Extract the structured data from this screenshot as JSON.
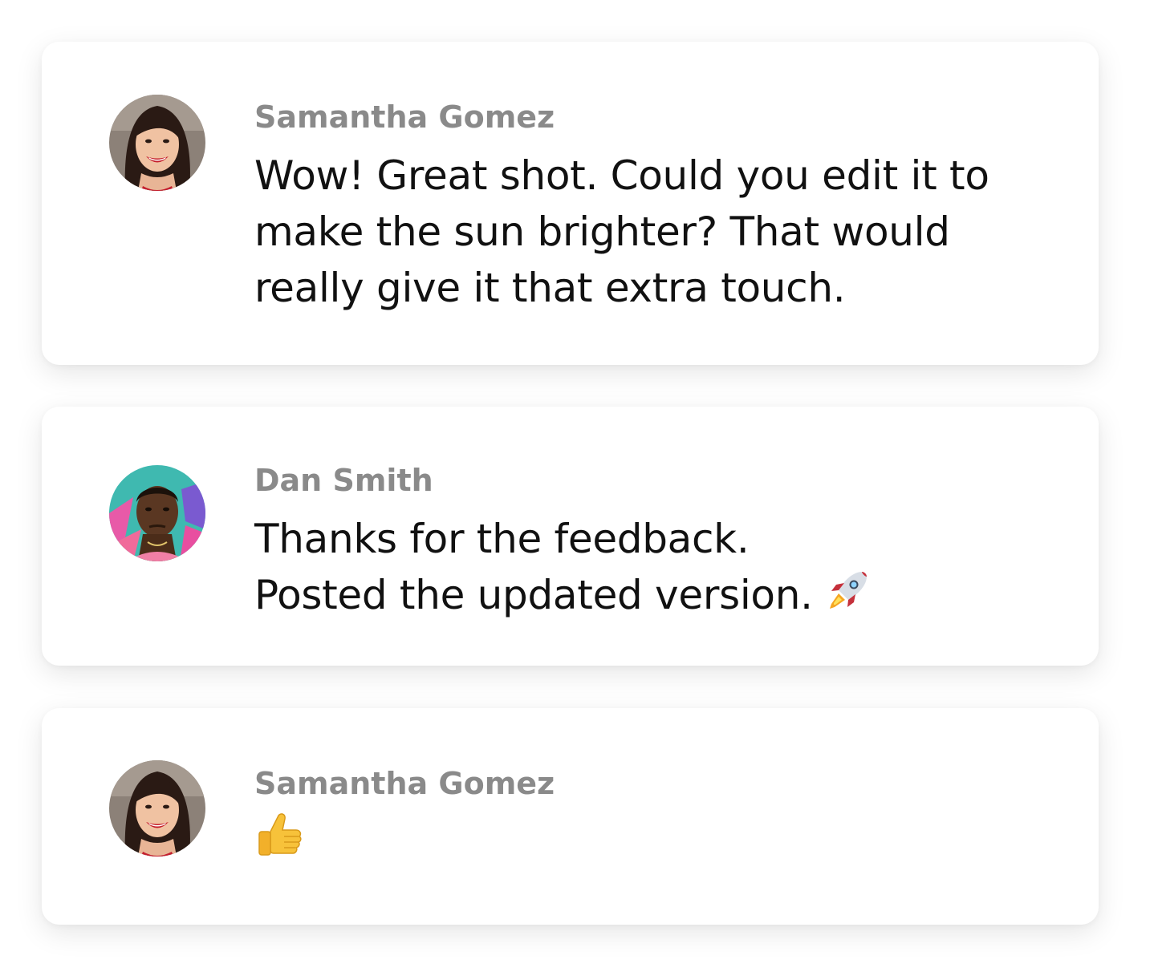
{
  "comments": [
    {
      "author": "Samantha Gomez",
      "avatar_icon": "avatar-samantha",
      "message_lines": [
        "Wow! Great shot. Could you edit it to",
        "make the sun brighter? That would",
        "really give it that extra touch."
      ]
    },
    {
      "author": "Dan Smith",
      "avatar_icon": "avatar-dan",
      "message_lines": [
        "Thanks for the feedback.",
        "Posted the updated version."
      ],
      "emoji": "rocket-emoji"
    },
    {
      "author": "Samantha Gomez",
      "avatar_icon": "avatar-samantha",
      "emoji": "thumbs-up-emoji"
    }
  ],
  "colors": {
    "author": "#8a8a8a",
    "text": "#111111",
    "card": "#ffffff"
  }
}
